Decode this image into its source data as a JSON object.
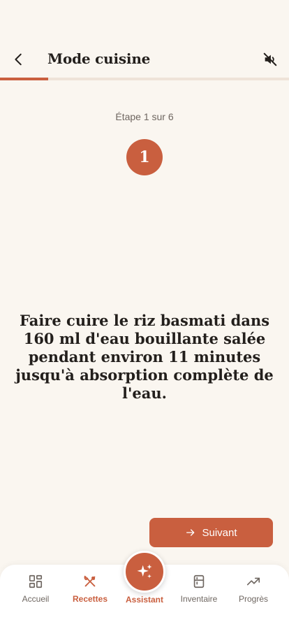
{
  "header": {
    "title": "Mode cuisine",
    "back_icon": "chevron-left-icon",
    "mute_icon": "volume-mute-icon"
  },
  "progress": {
    "current_step": 1,
    "total_steps": 6,
    "fraction": 0.1667,
    "color": "#c95f3f"
  },
  "step": {
    "label": "Étape 1 sur 6",
    "number": "1",
    "instruction": "Faire cuire le riz basmati dans 160 ml d'eau bouillante salée pendant environ 11 minutes jusqu'à absorption complète de l'eau."
  },
  "next_button": {
    "label": "Suivant",
    "icon": "arrow-right-icon"
  },
  "nav": {
    "items": [
      {
        "label": "Accueil",
        "icon": "dashboard-icon",
        "active": false
      },
      {
        "label": "Recettes",
        "icon": "utensils-icon",
        "active": true
      },
      {
        "label": "Assistant",
        "icon": "sparkles-icon",
        "active": false
      },
      {
        "label": "Inventaire",
        "icon": "fridge-icon",
        "active": false
      },
      {
        "label": "Progrès",
        "icon": "trending-up-icon",
        "active": false
      }
    ]
  },
  "colors": {
    "accent": "#c95f3f",
    "background": "#faf6f0",
    "text": "#231f1c",
    "muted": "#6e6660"
  }
}
